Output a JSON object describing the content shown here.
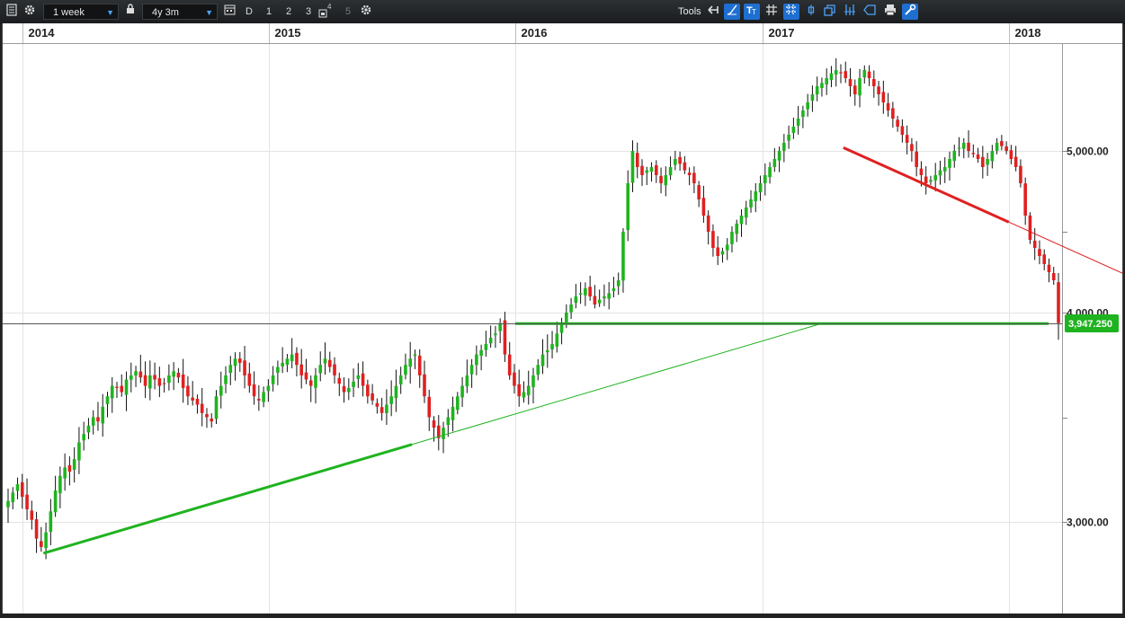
{
  "toolbar": {
    "interval": "1 week",
    "range": "4y 3m",
    "day_label": "D",
    "num_buttons": [
      "1",
      "2",
      "3",
      "4",
      "5"
    ],
    "tools_label": "Tools"
  },
  "chart_data": {
    "type": "candlestick",
    "x_ticks": [
      "2014",
      "2015",
      "2016",
      "2017",
      "2018"
    ],
    "y_ticks": [
      "3,000.00",
      "4,000.00",
      "5,000.00"
    ],
    "ylim": [
      2400,
      5200
    ],
    "grid": true,
    "last_price": "3,947.250",
    "trendlines": [
      {
        "from": {
          "date": "2014-02",
          "y": 2850
        },
        "to": {
          "date": "2015-08",
          "y": 3370
        },
        "extend_to_y": 3947.25,
        "color": "#1fb31f"
      },
      {
        "from": {
          "date": "2016-01",
          "y": 3947.25
        },
        "to": {
          "date": "2018-03",
          "y": 3947.25
        },
        "color": "#1fb31f"
      },
      {
        "from": {
          "date": "2017-05",
          "y": 5020
        },
        "to": {
          "date": "2018-01",
          "y": 4560
        },
        "extend_to_y": 4210,
        "color": "#e02020"
      }
    ],
    "series_close": [
      3100,
      3140,
      3180,
      3120,
      3060,
      3010,
      2920,
      2880,
      2950,
      3050,
      3150,
      3220,
      3260,
      3240,
      3300,
      3380,
      3420,
      3460,
      3500,
      3480,
      3550,
      3600,
      3650,
      3640,
      3620,
      3680,
      3700,
      3720,
      3690,
      3650,
      3700,
      3680,
      3650,
      3660,
      3700,
      3720,
      3690,
      3640,
      3600,
      3580,
      3560,
      3520,
      3500,
      3480,
      3600,
      3650,
      3700,
      3750,
      3780,
      3760,
      3700,
      3650,
      3600,
      3580,
      3620,
      3650,
      3700,
      3740,
      3760,
      3780,
      3800,
      3750,
      3700,
      3680,
      3650,
      3700,
      3750,
      3780,
      3740,
      3700,
      3660,
      3620,
      3640,
      3670,
      3700,
      3650,
      3600,
      3580,
      3550,
      3520,
      3560,
      3600,
      3650,
      3700,
      3750,
      3780,
      3800,
      3700,
      3600,
      3500,
      3450,
      3400,
      3450,
      3500,
      3550,
      3600,
      3650,
      3700,
      3750,
      3800,
      3820,
      3850,
      3880,
      3900,
      3950,
      3800,
      3700,
      3650,
      3600,
      3620,
      3650,
      3700,
      3750,
      3800,
      3820,
      3850,
      3900,
      3950,
      4000,
      4050,
      4100,
      4120,
      4150,
      4100,
      4050,
      4080,
      4100,
      4120,
      4150,
      4200,
      4500,
      4800,
      5000,
      4900,
      4850,
      4880,
      4900,
      4850,
      4800,
      4850,
      4900,
      4950,
      4920,
      4880,
      4850,
      4800,
      4700,
      4600,
      4500,
      4400,
      4350,
      4380,
      4420,
      4500,
      4550,
      4600,
      4650,
      4700,
      4750,
      4800,
      4850,
      4900,
      4950,
      5000,
      5050,
      5100,
      5150,
      5200,
      5250,
      5300,
      5350,
      5400,
      5420,
      5450,
      5480,
      5500,
      5480,
      5450,
      5400,
      5350,
      5450,
      5500,
      5450,
      5400,
      5350,
      5300,
      5250,
      5200,
      5150,
      5100,
      5050,
      5000,
      4900,
      4850,
      4800,
      4820,
      4850,
      4880,
      4900,
      4950,
      5000,
      5020,
      5050,
      5000,
      4980,
      4950,
      4900,
      4950,
      5000,
      5050,
      5030,
      5000,
      4950,
      4900,
      4800,
      4600,
      4450,
      4400,
      4350,
      4300,
      4250,
      4200,
      3950
    ]
  }
}
